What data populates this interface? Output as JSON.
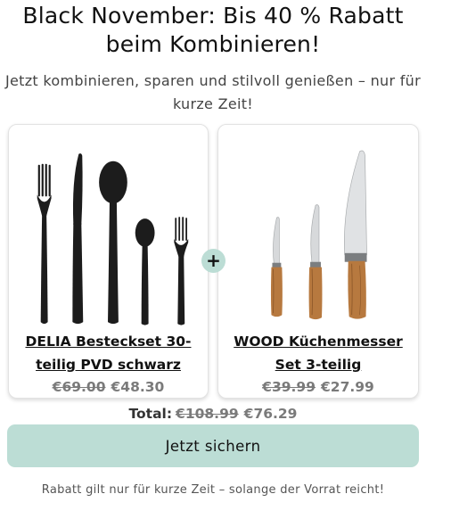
{
  "headline": "Black November: Bis 40 % Rabatt beim Kombinieren!",
  "subline": "Jetzt kombinieren, sparen und stilvoll genießen – nur für kurze Zeit!",
  "products": [
    {
      "name": "DELIA Besteckset 30-teilig PVD schwarz",
      "old_price": "€69.00",
      "new_price": "€48.30"
    },
    {
      "name": "WOOD Küchenmesser Set 3-teilig",
      "old_price": "€39.99",
      "new_price": "€27.99"
    }
  ],
  "plus_symbol": "+",
  "total": {
    "label": "Total:",
    "old_price": "€108.99",
    "new_price": "€76.29"
  },
  "cta_label": "Jetzt sichern",
  "footnote": "Rabatt gilt nur für kurze Zeit – solange der Vorrat reicht!",
  "colors": {
    "accent": "#bcddd5",
    "price_grey": "#7a7a7a",
    "cutlery_black": "#1c1c1c",
    "handle_wood": "#b7793f"
  },
  "icons": [
    "cutlery-set-image",
    "knife-set-image",
    "plus-icon"
  ]
}
